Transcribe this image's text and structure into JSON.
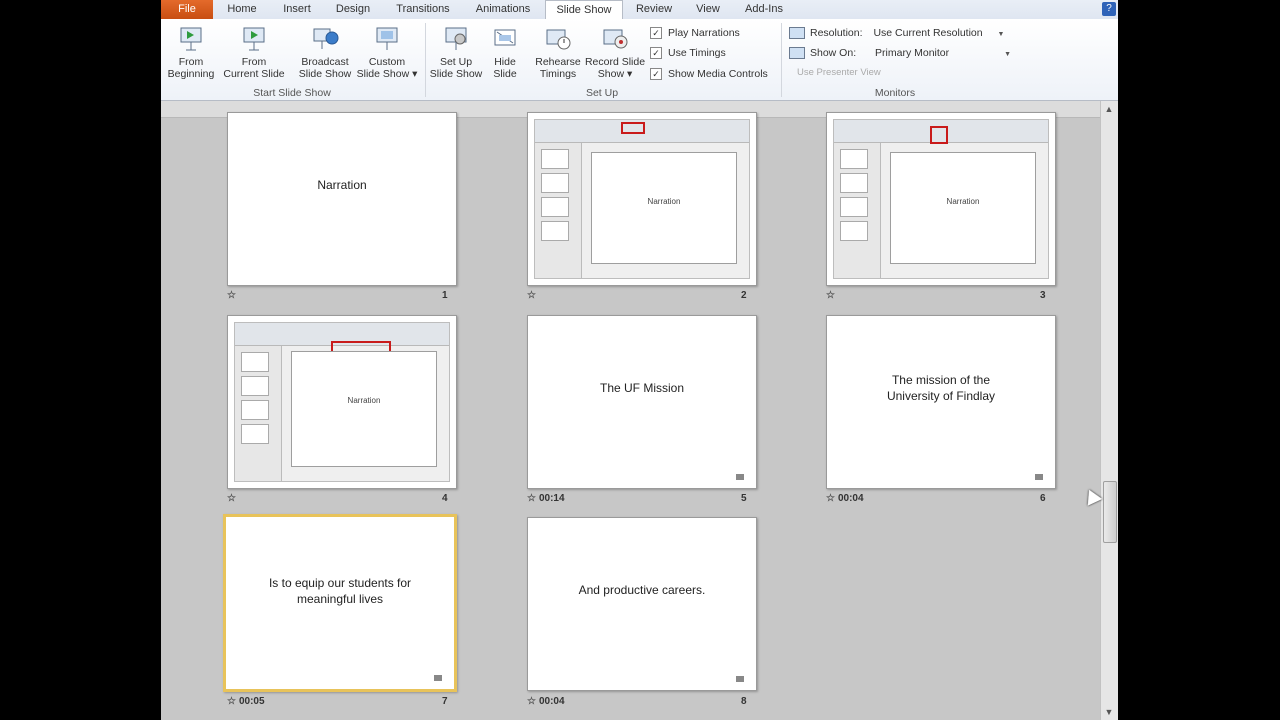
{
  "tabs": [
    "File",
    "Home",
    "Insert",
    "Design",
    "Transitions",
    "Animations",
    "Slide Show",
    "Review",
    "View",
    "Add-Ins"
  ],
  "ribbon": {
    "groups": {
      "start": "Start Slide Show",
      "setup": "Set Up",
      "monitors": "Monitors"
    },
    "buttons": {
      "from_beginning": [
        "From",
        "Beginning"
      ],
      "from_current": [
        "From",
        "Current Slide"
      ],
      "broadcast": [
        "Broadcast",
        "Slide Show"
      ],
      "custom": [
        "Custom",
        "Slide Show ▾"
      ],
      "setup": [
        "Set Up",
        "Slide Show"
      ],
      "hide": [
        "Hide",
        "Slide"
      ],
      "rehearse": [
        "Rehearse",
        "Timings"
      ],
      "record": [
        "Record Slide",
        "Show ▾"
      ]
    },
    "checks": {
      "play_narrations": "Play Narrations",
      "use_timings": "Use Timings",
      "show_media": "Show Media Controls"
    },
    "monitors": {
      "resolution_label": "Resolution:",
      "resolution_value": "Use Current Resolution",
      "show_on_label": "Show On:",
      "show_on_value": "Primary Monitor",
      "presenter_view": "Use Presenter View"
    }
  },
  "slides": [
    {
      "num": "1",
      "title": "Narration",
      "time": "",
      "kind": "title"
    },
    {
      "num": "2",
      "title": "Narration",
      "time": "",
      "kind": "screenshot"
    },
    {
      "num": "3",
      "title": "Narration",
      "time": "",
      "kind": "screenshot"
    },
    {
      "num": "4",
      "title": "Narration",
      "time": "",
      "kind": "screenshot"
    },
    {
      "num": "5",
      "title": "The UF Mission",
      "time": "00:14",
      "kind": "title"
    },
    {
      "num": "6",
      "title": "The mission of the University of Findlay",
      "time": "00:04",
      "kind": "title"
    },
    {
      "num": "7",
      "title": "Is to equip our students for meaningful lives",
      "time": "00:05",
      "kind": "title"
    },
    {
      "num": "8",
      "title": "And productive careers.",
      "time": "00:04",
      "kind": "title"
    }
  ]
}
